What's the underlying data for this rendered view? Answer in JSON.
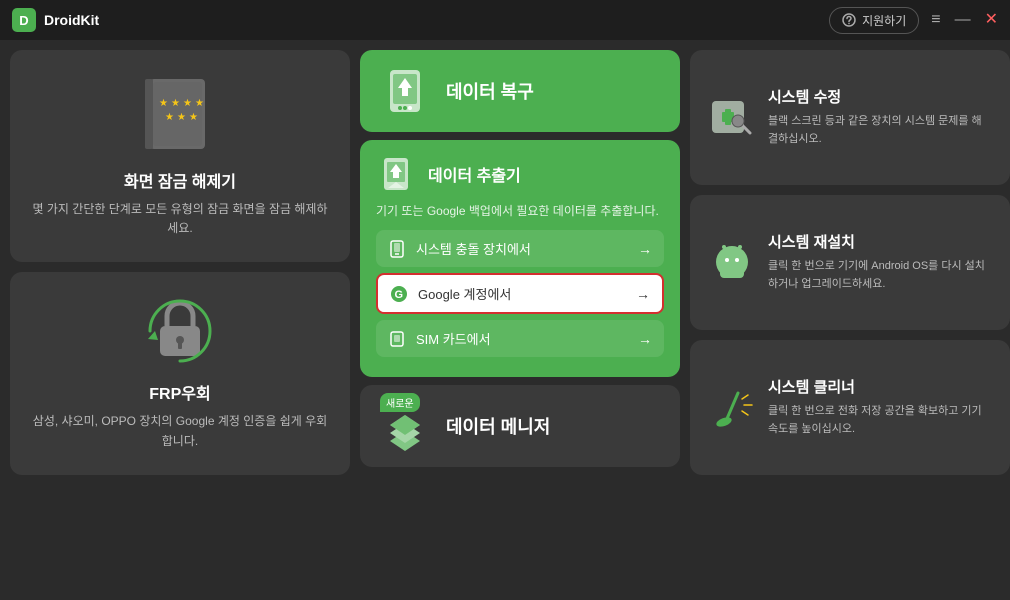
{
  "titlebar": {
    "logo": "D",
    "app_name": "DroidKit",
    "support_label": "지원하기",
    "menu_label": "≡",
    "minimize_label": "—",
    "close_label": "✕"
  },
  "left": {
    "unlock": {
      "title": "화면 잠금 해제기",
      "desc": "몇 가지 간단한 단계로 모든 유형의 잠금 화면을 잠금 해제하세요."
    },
    "frp": {
      "title": "FRP우회",
      "desc": "삼성, 샤오미, OPPO 장치의 Google 계정 인증을 쉽게 우회합니다."
    }
  },
  "center": {
    "recovery": {
      "label": "데이터 복구"
    },
    "extractor": {
      "title": "데이터 추출기",
      "desc": "기기 또는 Google 백업에서 필요한 데이터를 추출합니다.",
      "options": [
        {
          "id": "device",
          "label": "시스템 충돌 장치에서",
          "highlighted": false
        },
        {
          "id": "google",
          "label": "Google 계정에서",
          "highlighted": true
        },
        {
          "id": "sim",
          "label": "SIM 카드에서",
          "highlighted": false
        }
      ]
    },
    "manager": {
      "label": "데이터 메니저",
      "new_badge": "새로운"
    }
  },
  "right": {
    "cards": [
      {
        "id": "system-repair",
        "title": "시스템 수정",
        "desc": "블랙 스크린 등과 같은 장치의 시스템 문제를 해결하십시오."
      },
      {
        "id": "system-reinstall",
        "title": "시스템 재설치",
        "desc": "클릭 한 번으로 기기에 Android OS를 다시 설치하거나 업그레이드하세요."
      },
      {
        "id": "system-cleaner",
        "title": "시스템 클리너",
        "desc": "클릭 한 번으로 전화 저장 공간을 확보하고 기기 속도를 높이십시오."
      }
    ]
  }
}
